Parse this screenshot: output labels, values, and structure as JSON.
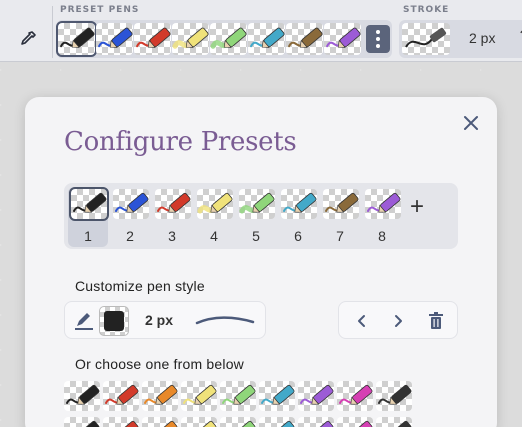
{
  "toolbar": {
    "preset_pens_label": "PRESET PENS",
    "stroke_label": "STROKE",
    "stroke_value": "2 px",
    "eyedropper_icon": "eyedropper-icon",
    "menu_icon": "vertical-dots-icon",
    "presets": [
      {
        "color": "#222222",
        "type": "pen"
      },
      {
        "color": "#2b54d6",
        "type": "pen"
      },
      {
        "color": "#d23a2a",
        "type": "pen"
      },
      {
        "color": "#f0e27a",
        "type": "highlighter"
      },
      {
        "color": "#8fd67a",
        "type": "highlighter"
      },
      {
        "color": "#43a9c9",
        "type": "pen"
      },
      {
        "color": "#8a6a3a",
        "type": "pen"
      },
      {
        "color": "#9c5bd6",
        "type": "pen"
      }
    ]
  },
  "dialog": {
    "title": "Configure Presets",
    "close_icon": "close-icon",
    "presets": [
      {
        "number": "1",
        "color": "#222222",
        "type": "pen",
        "selected": true
      },
      {
        "number": "2",
        "color": "#2b54d6",
        "type": "pen"
      },
      {
        "number": "3",
        "color": "#d23a2a",
        "type": "pen"
      },
      {
        "number": "4",
        "color": "#f0e27a",
        "type": "highlighter"
      },
      {
        "number": "5",
        "color": "#8fd67a",
        "type": "highlighter"
      },
      {
        "number": "6",
        "color": "#43a9c9",
        "type": "pen"
      },
      {
        "number": "7",
        "color": "#8a6a3a",
        "type": "pen"
      },
      {
        "number": "8",
        "color": "#9c5bd6",
        "type": "pen"
      }
    ],
    "add_label": "+",
    "customize_label": "Customize pen style",
    "pen_color": "#222222",
    "pen_size": "2 px",
    "stroke_color": "#4c5a7a",
    "choose_label": "Or choose one from below",
    "grid_pens": [
      "#222222",
      "#d23a2a",
      "#e8892a",
      "#f0e27a",
      "#8fd67a",
      "#43a9c9",
      "#9c5bd6",
      "#d63fb3",
      "#333333",
      "#222222",
      "#d23a2a",
      "#e8892a",
      "#f0e27a",
      "#8fd67a",
      "#43a9c9",
      "#9c5bd6",
      "#d63fb3",
      "#333333"
    ]
  }
}
